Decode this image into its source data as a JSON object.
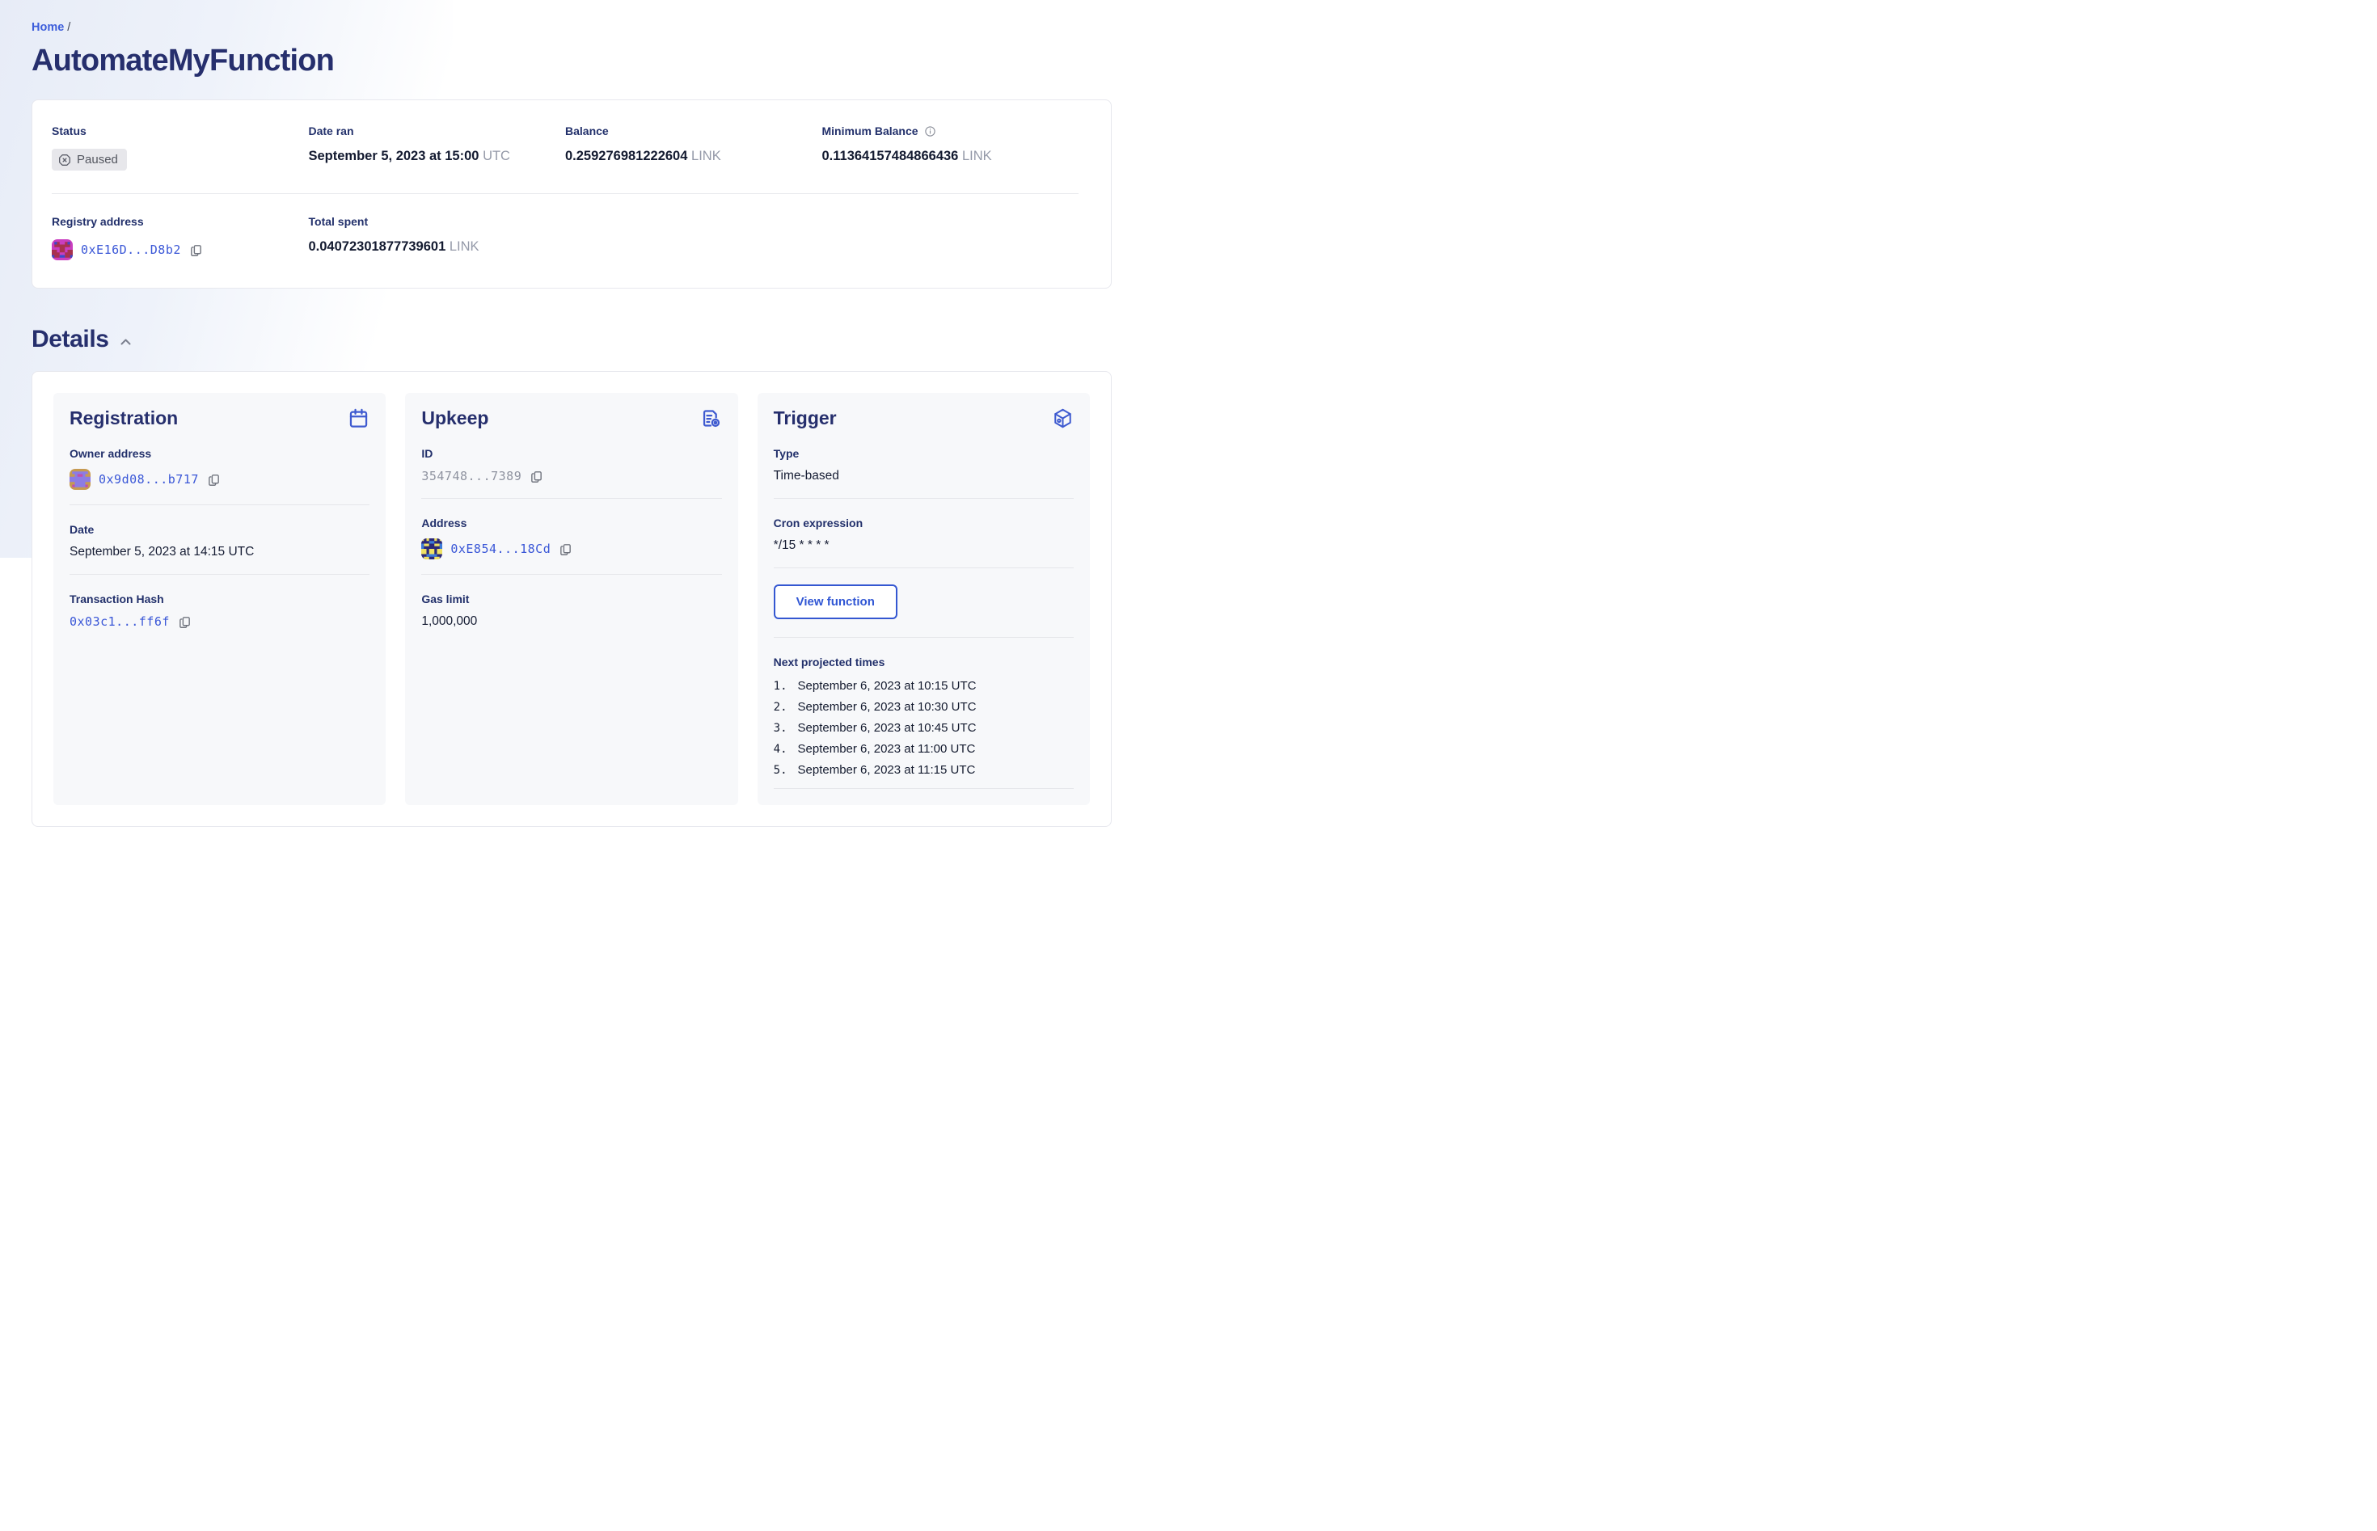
{
  "breadcrumb": {
    "home": "Home",
    "separator": "/"
  },
  "page_title": "AutomateMyFunction",
  "summary": {
    "status": {
      "label": "Status",
      "value": "Paused"
    },
    "date_ran": {
      "label": "Date ran",
      "value": "September 5, 2023 at 15:00",
      "suffix": "UTC"
    },
    "balance": {
      "label": "Balance",
      "value": "0.259276981222604",
      "suffix": "LINK"
    },
    "min_balance": {
      "label": "Minimum Balance",
      "value": "0.11364157484866436",
      "suffix": "LINK"
    },
    "registry": {
      "label": "Registry address",
      "address": "0xE16D...D8b2",
      "identicon": {
        "bg": "#c93ec0",
        "fg": "#a8314f",
        "accent": "#3c49cc"
      }
    },
    "total_spent": {
      "label": "Total spent",
      "value": "0.04072301877739601",
      "suffix": "LINK"
    }
  },
  "details": {
    "heading": "Details",
    "registration": {
      "title": "Registration",
      "owner": {
        "label": "Owner address",
        "address": "0x9d08...b717",
        "identicon": {
          "bg": "#c69a52",
          "fg": "#8c7ce4",
          "accent": "#c04fae"
        }
      },
      "date": {
        "label": "Date",
        "value": "September 5, 2023 at 14:15 UTC"
      },
      "tx": {
        "label": "Transaction Hash",
        "value": "0x03c1...ff6f"
      }
    },
    "upkeep": {
      "title": "Upkeep",
      "id": {
        "label": "ID",
        "value": "354748...7389"
      },
      "address": {
        "label": "Address",
        "value": "0xE854...18Cd",
        "identicon": {
          "bg": "#2b2878",
          "fg": "#efe163",
          "accent": "#3d7bd8"
        }
      },
      "gas": {
        "label": "Gas limit",
        "value": "1,000,000"
      }
    },
    "trigger": {
      "title": "Trigger",
      "type": {
        "label": "Type",
        "value": "Time-based"
      },
      "cron": {
        "label": "Cron expression",
        "value": "*/15 * * * *"
      },
      "view_function_label": "View function",
      "next_times": {
        "label": "Next projected times",
        "items": [
          {
            "n": "1.",
            "text": "September 6, 2023 at 10:15 UTC"
          },
          {
            "n": "2.",
            "text": "September 6, 2023 at 10:30 UTC"
          },
          {
            "n": "3.",
            "text": "September 6, 2023 at 10:45 UTC"
          },
          {
            "n": "4.",
            "text": "September 6, 2023 at 11:00 UTC"
          },
          {
            "n": "5.",
            "text": "September 6, 2023 at 11:15 UTC"
          }
        ]
      }
    }
  },
  "colors": {
    "accent_blue": "#375bd2",
    "heading_navy": "#262f6d",
    "label_navy": "#22306b",
    "value_dark": "#131a30",
    "muted_gray": "#9499a8",
    "link_blue": "#3a57d7",
    "badge_bg": "#e7e7eb",
    "badge_text": "#53565f",
    "panel_bg": "#f7f8fa",
    "card_border": "#e7e8ee"
  }
}
